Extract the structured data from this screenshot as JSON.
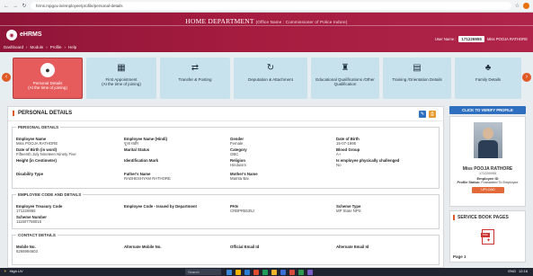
{
  "browser": {
    "url": "hrms.mpgov.in/employee/profile/personal-details",
    "icons": [
      "back-arrow-icon",
      "forward-arrow-icon",
      "reload-icon",
      "star-icon"
    ]
  },
  "header": {
    "title": "HOME DEPARTMENT",
    "subtitle": "(Office Name : Commissioner of Police Indore)",
    "app_name": "eHRMS",
    "menu": [
      "Dashboard",
      "Module",
      "Profile",
      "Help"
    ],
    "menu_sep": "›",
    "user_label": "User Name :",
    "user_id": "171226955",
    "user_name": "Miss POOJA RATHORE"
  },
  "tabs": [
    {
      "label": "Personal Details",
      "sub": "(At the time of joining)",
      "icon": "person-icon",
      "active": true
    },
    {
      "label": "First Appointment",
      "sub": "(At the time of joining)",
      "icon": "calendar-icon",
      "active": false
    },
    {
      "label": "Transfer & Posting",
      "sub": "",
      "icon": "transfer-icon",
      "active": false
    },
    {
      "label": "Deputation & Attachment",
      "sub": "",
      "icon": "deputation-icon",
      "active": false
    },
    {
      "label": "Educational Qualifications /Other",
      "sub": "Qualification",
      "icon": "graduation-icon",
      "active": false
    },
    {
      "label": "Training /Orientation Details",
      "sub": "",
      "icon": "training-icon",
      "active": false
    },
    {
      "label": "Family Details",
      "sub": "",
      "icon": "family-icon",
      "active": false
    }
  ],
  "panel": {
    "title": "PERSONAL DETAILS",
    "personal": {
      "legend": "PERSONAL DETAILS",
      "rows": [
        [
          {
            "label": "Employee Name",
            "value": "Miss POOJA RATHORE"
          },
          {
            "label": "Employee Name (Hindi)",
            "value": "पूजा राठौर"
          },
          {
            "label": "Gender",
            "value": "Female"
          },
          {
            "label": "Date of Birth",
            "value": "15-07-1995"
          }
        ],
        [
          {
            "label": "Date of Birth (in word)",
            "value": "Fifteenth July Nineteen Ninety Five"
          },
          {
            "label": "Marital Status",
            "value": ""
          },
          {
            "label": "Category",
            "value": "OBC"
          },
          {
            "label": "Blood Group",
            "value": "A+"
          }
        ],
        [
          {
            "label": "Height (in Centimeter)",
            "value": ""
          },
          {
            "label": "Identification Mark",
            "value": ""
          },
          {
            "label": "Religion",
            "value": "Hinduism"
          },
          {
            "label": "Is employee physically challenged",
            "value": "No"
          }
        ],
        [
          {
            "label": "Disability Type",
            "value": ""
          },
          {
            "label": "Father's Name",
            "value": "RADHESHYAM RATHORE"
          },
          {
            "label": "Mother's Name",
            "value": "Mamta Bai"
          },
          {
            "label": "",
            "value": ""
          }
        ]
      ]
    },
    "code": {
      "legend": "EMPLOYEE CODE AND DETAILS",
      "rows": [
        [
          {
            "label": "Employee Treasury Code",
            "value": "171226955"
          },
          {
            "label": "Employee Code - Issued by Department",
            "value": ""
          },
          {
            "label": "PAN",
            "value": "CRBPR5535J"
          },
          {
            "label": "Scheme Type",
            "value": "MP State NPS"
          }
        ],
        [
          {
            "label": "Scheme Number",
            "value": "111507758015"
          },
          {
            "label": "",
            "value": ""
          },
          {
            "label": "",
            "value": ""
          },
          {
            "label": "",
            "value": ""
          }
        ]
      ]
    },
    "contact": {
      "legend": "CONTACT DETAILS",
      "rows": [
        [
          {
            "label": "Mobile No.",
            "value": "6266994603"
          },
          {
            "label": "Alternate Mobile No.",
            "value": ""
          },
          {
            "label": "Official Email Id",
            "value": ""
          },
          {
            "label": "Alternate Email Id",
            "value": ""
          }
        ]
      ]
    }
  },
  "profile": {
    "verify_label": "CLICK TO VERIFY PROFILE",
    "name": "Miss POOJA RATHORE",
    "emp_id": "171226955",
    "emp_id_label": "Employee ID",
    "status_label": "Profile Status:",
    "status_value": "Forwarded To Employee",
    "upload_label": "UPLOAD"
  },
  "service_book": {
    "title": "SERVICE BOOK PAGES",
    "pdf_tag": "PDF",
    "page_label": "Page 1"
  },
  "taskbar": {
    "weather": "High UV",
    "search_label": "Search",
    "lang": "ENG",
    "time": "12:16"
  }
}
